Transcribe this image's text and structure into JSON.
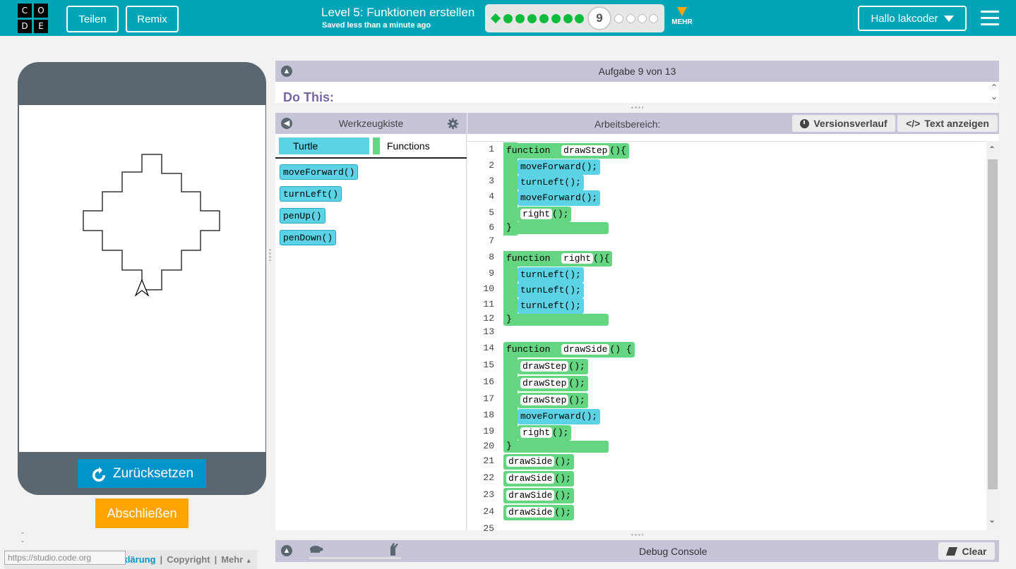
{
  "header": {
    "logo_letters": [
      "C",
      "O",
      "D",
      "E"
    ],
    "share_label": "Teilen",
    "remix_label": "Remix",
    "level_title": "Level 5: Funktionen erstellen",
    "saved_status": "Saved less than a minute ago",
    "current_puzzle": "9",
    "completed_puzzles": 8,
    "remaining_puzzles": 4,
    "more_label": "MEHR",
    "user_label": "Hallo lakcoder",
    "accent_color": "#00a5b8"
  },
  "visualization": {
    "reset_label": "Zurücksetzen",
    "finish_label": "Abschließen"
  },
  "footer": {
    "url_tooltip": "https://studio.code.org",
    "privacy_label": "Datenschutzerklärung",
    "copyright_label": "Copyright",
    "more_label": "Mehr",
    "sep": "|"
  },
  "instructions": {
    "header": "Aufgabe 9 von 13",
    "do_this": "Do This:"
  },
  "toolbox": {
    "title": "Werkzeugkiste",
    "categories": [
      "Turtle",
      "Functions"
    ],
    "blocks": [
      "moveForward()",
      "turnLeft()",
      "penUp()",
      "penDown()"
    ]
  },
  "workspace": {
    "title": "Arbeitsbereich:",
    "version_history_label": "Versionsverlauf",
    "show_text_label": "Text anzeigen",
    "line_numbers": [
      "1",
      "2",
      "3",
      "4",
      "5",
      "6",
      "7",
      "8",
      "9",
      "10",
      "11",
      "12",
      "13",
      "14",
      "15",
      "16",
      "17",
      "18",
      "19",
      "20",
      "21",
      "22",
      "23",
      "24",
      "25"
    ],
    "code": {
      "f1_kw": "function",
      "f1_name": "drawStep",
      "f1_tail": "(){",
      "l2": "moveForward();",
      "l3": "turnLeft();",
      "l4": "moveForward();",
      "l5_name": "right",
      "l5_tail": "();",
      "close": "}",
      "f2_kw": "function",
      "f2_name": "right",
      "f2_tail": "(){",
      "l9": "turnLeft();",
      "l10": "turnLeft();",
      "l11": "turnLeft();",
      "f3_kw": "function",
      "f3_name": "drawSide",
      "f3_tail": "() {",
      "ds_name": "drawStep",
      "ds_tail": "();",
      "l18": "moveForward();",
      "l19_name": "right",
      "l19_tail": "();",
      "side_name": "drawSide",
      "side_tail": "();"
    }
  },
  "debug": {
    "title": "Debug Console",
    "clear_label": "Clear"
  }
}
